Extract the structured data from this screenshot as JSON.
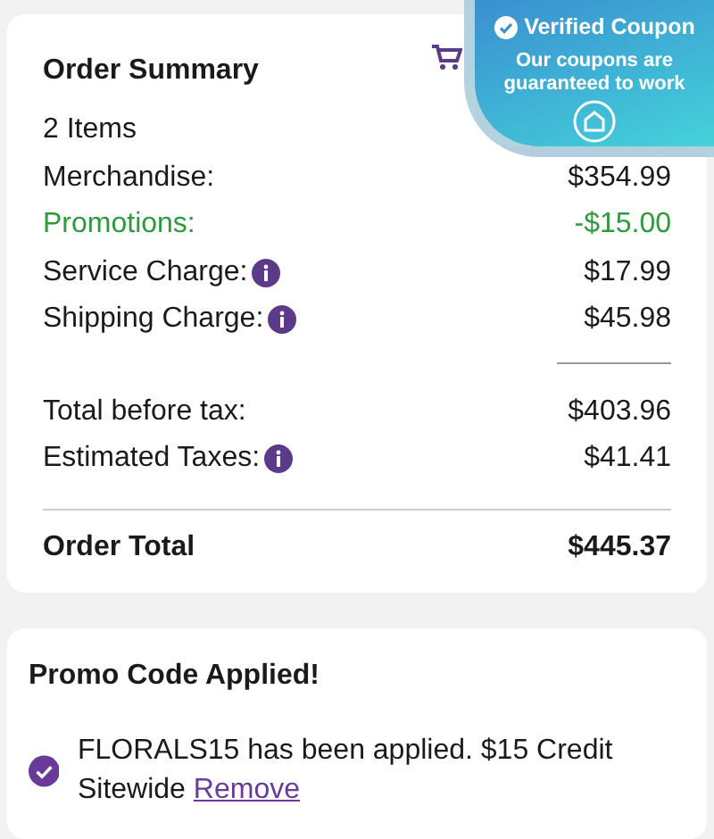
{
  "summary": {
    "title": "Order Summary",
    "item_count": "2 Items",
    "lines": [
      {
        "label": "Merchandise:",
        "value": "$354.99",
        "kind": "plain",
        "info": false
      },
      {
        "label": "Promotions:",
        "value": "-$15.00",
        "kind": "discount",
        "info": false
      },
      {
        "label": "Service Charge:",
        "value": "$17.99",
        "kind": "plain",
        "info": true
      },
      {
        "label": "Shipping Charge:",
        "value": "$45.98",
        "kind": "plain",
        "info": true
      }
    ],
    "subtotals": [
      {
        "label": "Total before tax:",
        "value": "$403.96",
        "info": false
      },
      {
        "label": "Estimated Taxes:",
        "value": "$41.41",
        "info": true
      }
    ],
    "total": {
      "label": "Order Total",
      "value": "$445.37"
    }
  },
  "coupon_badge": {
    "title": "Verified Coupon",
    "text": "Our coupons are guaranteed to work"
  },
  "promo": {
    "title": "Promo Code Applied!",
    "message": "FLORALS15 has been applied. $15 Credit Sitewide",
    "link": "Remove"
  }
}
